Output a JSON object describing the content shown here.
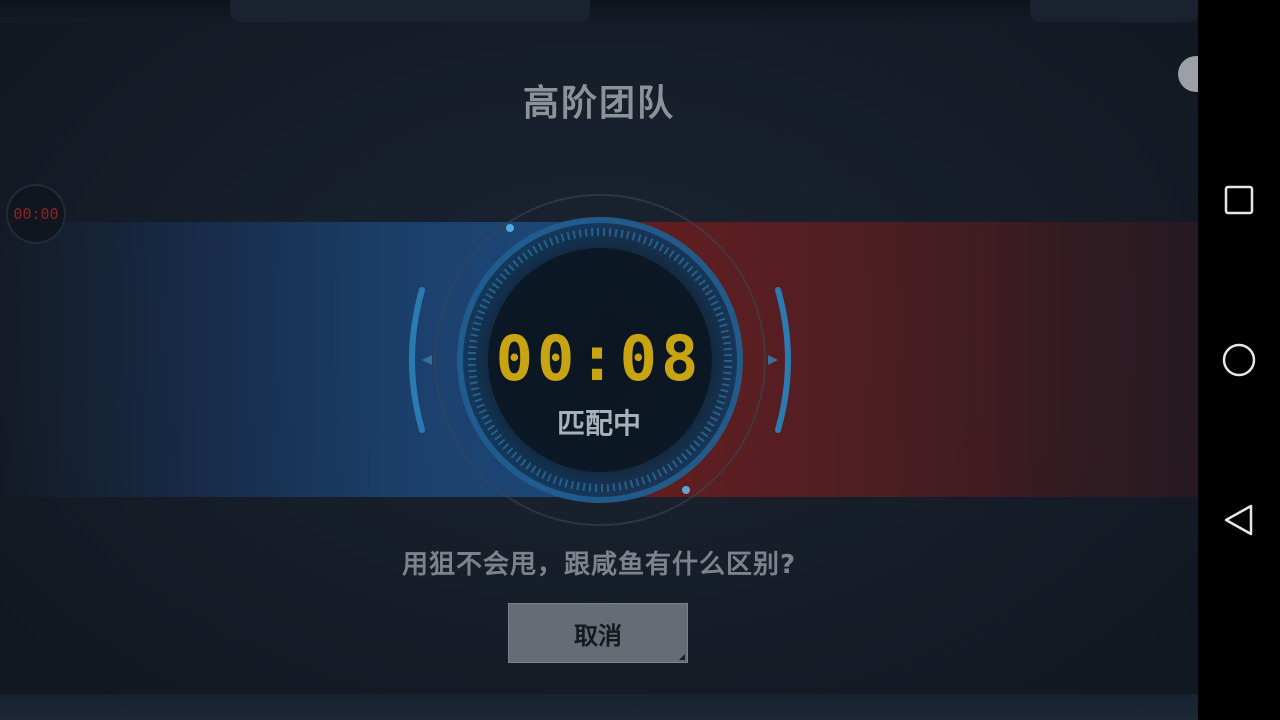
{
  "game": {
    "mode_title": "高阶团队",
    "mini_timer": "00:00",
    "countdown": "00:08",
    "status_label": "匹配中",
    "tip": "用狙不会甩，跟咸鱼有什么区别?",
    "cancel_label": "取消"
  },
  "colors": {
    "timer": "#c9a412",
    "team_blue": "#1e4e82",
    "team_red": "#6e1e1e",
    "button_bg": "#666c74"
  },
  "navbar": {
    "icons": [
      "recent-apps-icon",
      "home-icon",
      "back-icon"
    ]
  }
}
